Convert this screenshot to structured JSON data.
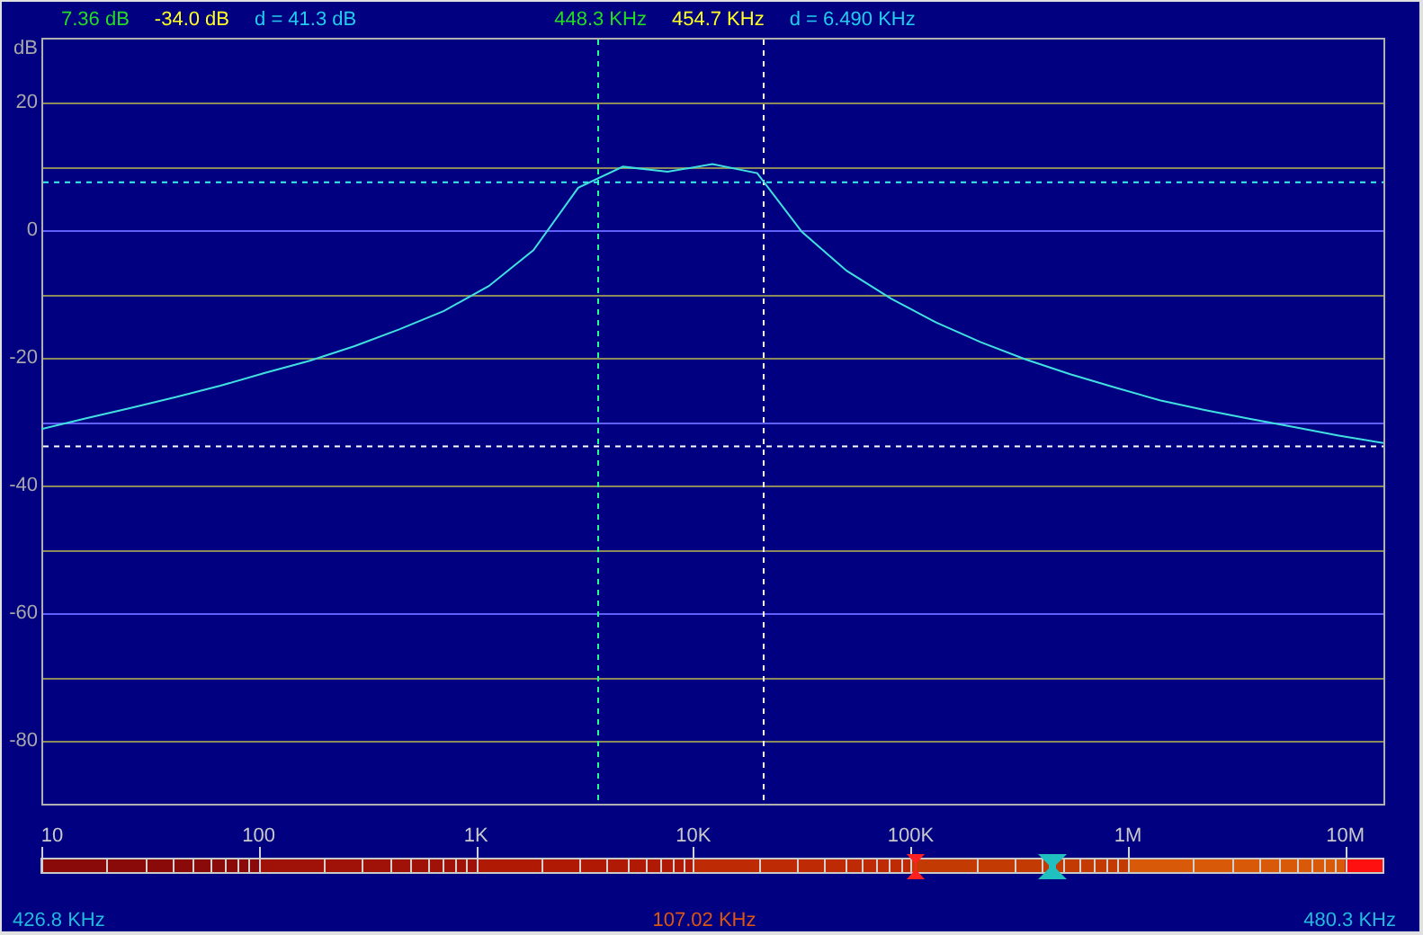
{
  "readouts": [
    {
      "text": "7.36 dB",
      "color": "#22dd22"
    },
    {
      "text": "-34.0 dB",
      "color": "#ffff22"
    },
    {
      "text": "d = 41.3 dB",
      "color": "#22ccee"
    },
    {
      "text": "448.3 KHz",
      "color": "#22dd22"
    },
    {
      "text": "454.7 KHz",
      "color": "#ffff22"
    },
    {
      "text": "d = 6.490 KHz",
      "color": "#22ccee"
    }
  ],
  "plot": {
    "chart_data": {
      "type": "line",
      "ylabel": "dB",
      "ylim": [
        -90,
        30
      ],
      "yticks": [
        20,
        0,
        -20,
        -40,
        -60,
        -80
      ],
      "grid": true,
      "ref_lines": [
        {
          "axis": "y",
          "value": 7.36,
          "color": "#40f0f0"
        },
        {
          "axis": "y",
          "value": -34.0,
          "color": "#ffffff"
        }
      ],
      "categories": [
        null,
        null,
        null,
        null,
        null,
        null,
        null,
        null,
        null,
        null,
        null,
        null,
        null,
        null,
        null,
        null,
        null,
        null,
        null,
        null,
        null,
        null,
        null,
        null,
        null,
        null,
        null,
        null,
        null,
        null,
        null
      ],
      "series": [
        {
          "color": "#40e0e0",
          "values": [
            -31.3,
            -29.6,
            -28.0,
            -26.3,
            -24.5,
            -22.5,
            -20.6,
            -18.3,
            -15.7,
            -12.8,
            -8.9,
            -3.3,
            6.5,
            9.8,
            9.0,
            10.2,
            8.8,
            -0.4,
            -6.5,
            -10.9,
            -14.6,
            -17.7,
            -20.4,
            -22.7,
            -24.8,
            -26.8,
            -28.3,
            -29.7,
            -31.0,
            -32.3,
            -33.5
          ]
        }
      ]
    }
  },
  "scale": {
    "labels": [
      "10",
      "100",
      "1K",
      "10K",
      "100K",
      "1M",
      "10M"
    ]
  },
  "footer": [
    {
      "text": "426.8 KHz",
      "color": "#22bbdd"
    },
    {
      "text": "107.02 KHz",
      "color": "#dd5511"
    },
    {
      "text": "480.3 KHz",
      "color": "#22bbdd"
    }
  ]
}
